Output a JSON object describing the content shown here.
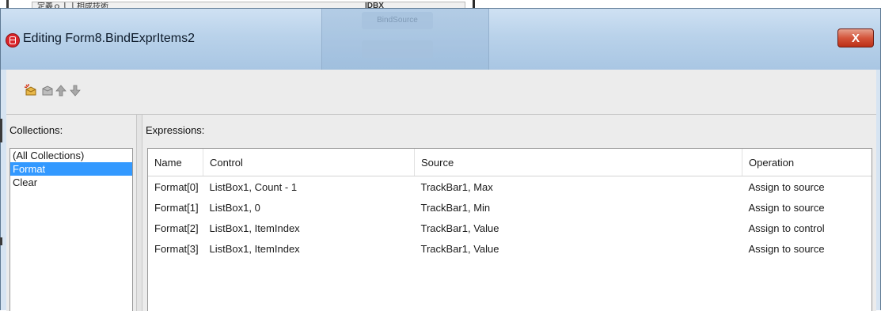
{
  "background": {
    "cell_text": "定義ｏｌｌ相成技術",
    "mid_text": "IDBX"
  },
  "window": {
    "title": "Editing Form8.BindExprItems2",
    "close_label": "X",
    "ghost_button_1": "BindSource",
    "ghost_button_2": ""
  },
  "toolbar": {
    "icons": [
      "new-item-icon",
      "delete-item-icon",
      "move-up-icon",
      "move-down-icon"
    ]
  },
  "collections": {
    "label": "Collections:",
    "items": [
      "(All Collections)",
      "Format",
      "Clear"
    ],
    "selected": "Format"
  },
  "expressions": {
    "label": "Expressions:",
    "columns": [
      "Name",
      "Control",
      "Source",
      "Operation"
    ],
    "rows": [
      {
        "name": "Format[0]",
        "control": "ListBox1, Count - 1",
        "source": "TrackBar1, Max",
        "operation": "Assign to source"
      },
      {
        "name": "Format[1]",
        "control": "ListBox1, 0",
        "source": "TrackBar1, Min",
        "operation": "Assign to source"
      },
      {
        "name": "Format[2]",
        "control": "ListBox1, ItemIndex",
        "source": "TrackBar1, Value",
        "operation": "Assign to control"
      },
      {
        "name": "Format[3]",
        "control": "ListBox1, ItemIndex",
        "source": "TrackBar1, Value",
        "operation": "Assign to source"
      }
    ]
  },
  "colors": {
    "selection": "#3399ff",
    "close_button": "#c8402a",
    "titlebar": "#b9d2ea"
  }
}
